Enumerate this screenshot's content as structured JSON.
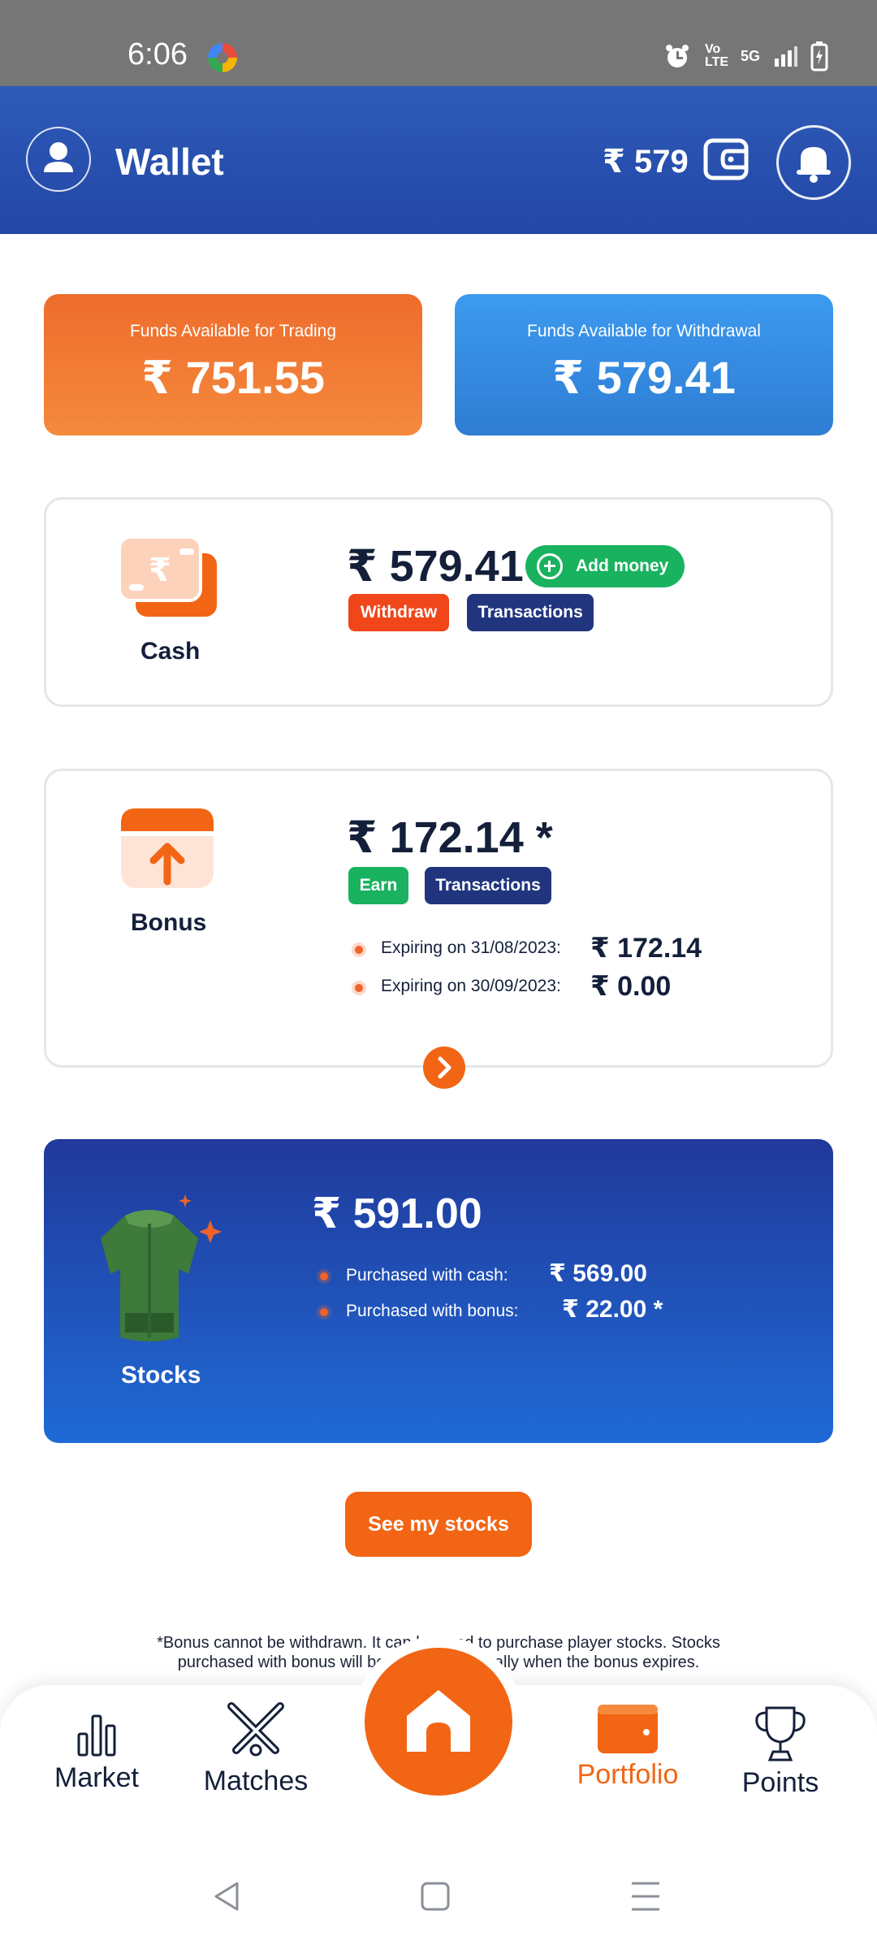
{
  "status_bar": {
    "time": "6:06",
    "network": "5G",
    "volte": "Vo LTE"
  },
  "header": {
    "title": "Wallet",
    "balance": "₹ 579"
  },
  "funds": {
    "trading": {
      "label": "Funds Available for Trading",
      "amount": "₹ 751.55"
    },
    "withdrawal": {
      "label": "Funds Available for Withdrawal",
      "amount": "₹ 579.41"
    }
  },
  "cash": {
    "label": "Cash",
    "amount": "₹ 579.41",
    "add_money": "Add money",
    "withdraw": "Withdraw",
    "transactions": "Transactions"
  },
  "bonus": {
    "label": "Bonus",
    "amount": "₹ 172.14 *",
    "earn": "Earn",
    "transactions": "Transactions",
    "expiries": [
      {
        "label": "Expiring on 31/08/2023:",
        "amount": "₹ 172.14"
      },
      {
        "label": "Expiring on 30/09/2023:",
        "amount": "₹ 0.00"
      }
    ]
  },
  "stocks": {
    "label": "Stocks",
    "amount": "₹ 591.00",
    "rows": [
      {
        "label": "Purchased with cash:",
        "amount": "₹ 569.00"
      },
      {
        "label": "Purchased with bonus:",
        "amount": "₹ 22.00 *"
      }
    ]
  },
  "see_stocks": "See my stocks",
  "note": {
    "line1": "*Bonus cannot be withdrawn. It can be used to purchase player stocks. Stocks",
    "line2": "purchased with bonus will be sold automatically when the bonus expires."
  },
  "nav": {
    "market": "Market",
    "matches": "Matches",
    "portfolio": "Portfolio",
    "points": "Points"
  },
  "colors": {
    "brand_orange": "#f26514",
    "header_blue": "#2347a6",
    "navy": "#21357f",
    "green": "#19b35f",
    "red": "#f0461a"
  }
}
